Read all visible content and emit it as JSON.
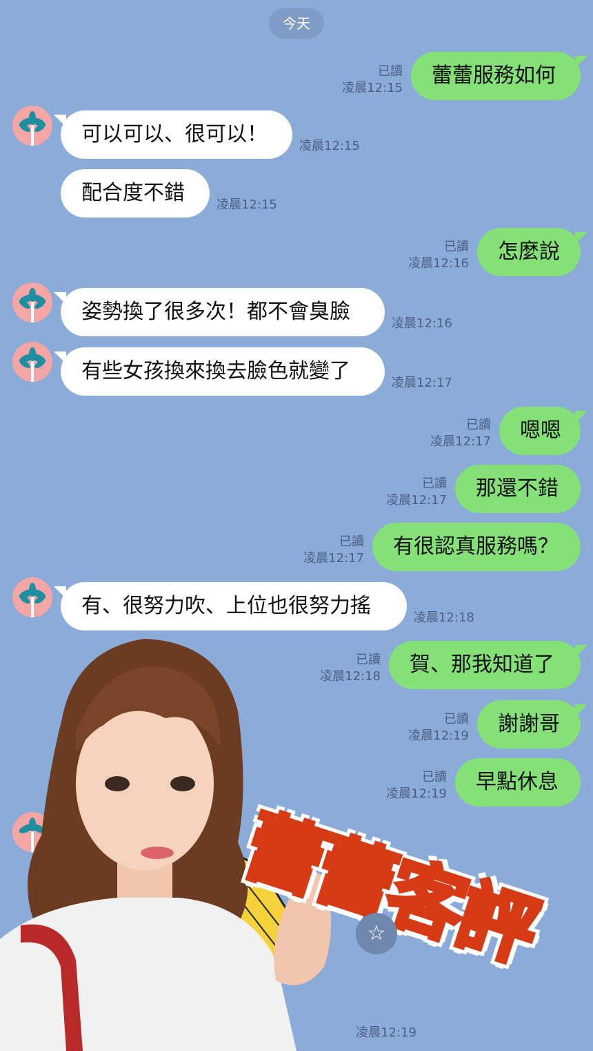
{
  "date_divider": "今天",
  "messages": [
    {
      "side": "right",
      "text": "蕾蕾服務如何",
      "read": "已讀",
      "time": "凌晨12:15"
    },
    {
      "side": "left",
      "text": "可以可以、很可以！",
      "time": "凌晨12:15"
    },
    {
      "side": "left",
      "text": "配合度不錯",
      "time": "凌晨12:15"
    },
    {
      "side": "right",
      "text": "怎麼說",
      "read": "已讀",
      "time": "凌晨12:16"
    },
    {
      "side": "left",
      "text": "姿勢換了很多次！都不會臭臉",
      "time": "凌晨12:16"
    },
    {
      "side": "left",
      "text": "有些女孩換來換去臉色就變了",
      "time": "凌晨12:17"
    },
    {
      "side": "right",
      "text": "嗯嗯",
      "read": "已讀",
      "time": "凌晨12:17"
    },
    {
      "side": "right",
      "text": "那還不錯",
      "read": "已讀",
      "time": "凌晨12:17"
    },
    {
      "side": "right",
      "text": "有很認真服務嗎？",
      "read": "已讀",
      "time": "凌晨12:17"
    },
    {
      "side": "left",
      "text": "有、很努力吹、上位也很努力搖",
      "time": "凌晨12:18"
    },
    {
      "side": "right",
      "text": "賀、那我知道了",
      "read": "已讀",
      "time": "凌晨12:18"
    },
    {
      "side": "right",
      "text": "謝謝哥",
      "read": "已讀",
      "time": "凌晨12:19"
    },
    {
      "side": "right",
      "text": "早點休息",
      "read": "已讀",
      "time": "凌晨12:19"
    }
  ],
  "bottom_time": "凌晨12:19",
  "overlay_title": "蕾蕾客評",
  "icons": {
    "avatar": "palm-tree-avatar-icon",
    "star": "star-icon"
  },
  "colors": {
    "background": "#8babd8",
    "bubble_out": "#84e077",
    "bubble_in": "#ffffff",
    "title_fill": "#f8d117",
    "title_stroke": "#d63b16"
  }
}
